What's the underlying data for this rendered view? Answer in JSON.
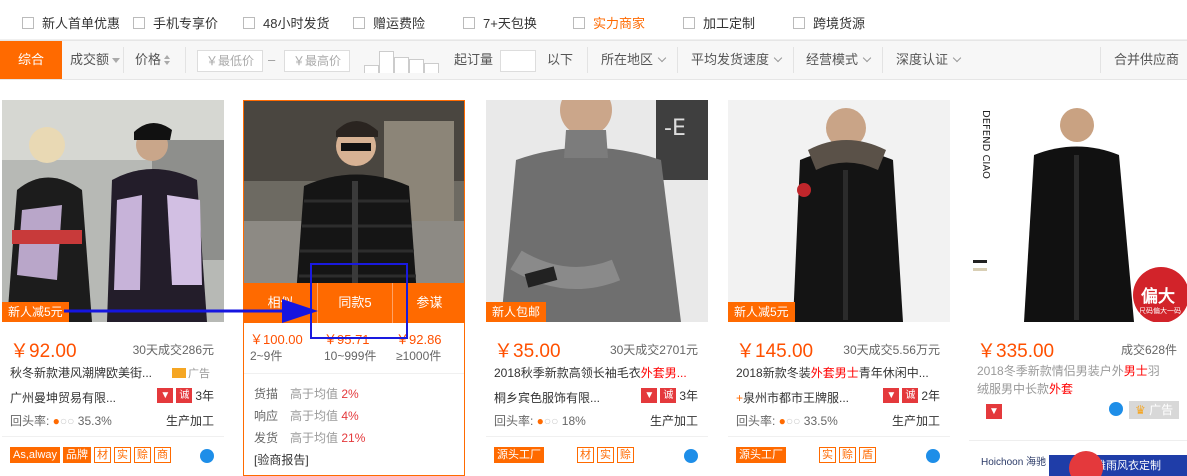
{
  "filters": [
    {
      "label": "新人首单优惠",
      "hot": false
    },
    {
      "label": "手机专享价",
      "hot": false
    },
    {
      "label": "48小时发货",
      "hot": false
    },
    {
      "label": "赠运费险",
      "hot": false
    },
    {
      "label": "7+天包换",
      "hot": false
    },
    {
      "label": "实力商家",
      "hot": true
    },
    {
      "label": "加工定制",
      "hot": false
    },
    {
      "label": "跨境货源",
      "hot": false
    }
  ],
  "sortbar": {
    "composite": "综合",
    "volume": "成交额",
    "price": "价格",
    "min_price_ph": "￥最低价",
    "dash": "–",
    "max_price_ph": "￥最高价",
    "moq_label": "起订量",
    "moq_suffix": "以下",
    "region": "所在地区",
    "ship_speed": "平均发货速度",
    "biz_mode": "经营模式",
    "cert": "深度认证",
    "merge": "合并供应商"
  },
  "colors": {
    "accent": "#ff6a00",
    "price": "#ff5000",
    "highlight_box": "#1a1adf",
    "arrow": "#1515e0"
  },
  "products": [
    {
      "tag": "新人减5元",
      "price": "￥92.00",
      "deals": "30天成交286元",
      "title_pre": "秋冬新款港风潮牌欧美街...",
      "title_em": "",
      "title_post": "",
      "company": "广州曼坤贸易有限...",
      "ad": "广告",
      "years": "3年",
      "metrics": "回头率: ",
      "rate": "35.3%",
      "mode": "生产加工",
      "icons": [
        "As,alway",
        "品牌",
        "材",
        "实",
        "赊",
        "商"
      ]
    },
    {
      "overlay": [
        "相似",
        "同款5",
        "参谋"
      ],
      "price_cols": [
        {
          "price": "￥100.00",
          "qty": "2~9件"
        },
        {
          "price": "￥95.71",
          "qty": "10~999件"
        },
        {
          "price": "￥92.86",
          "qty": "≥1000件"
        }
      ],
      "rows": [
        {
          "k": "货描",
          "v": "高于均值",
          "n": "2%"
        },
        {
          "k": "响应",
          "v": "高于均值",
          "n": "4%"
        },
        {
          "k": "发货",
          "v": "高于均值",
          "n": "21%"
        }
      ],
      "report": "[验商报告]"
    },
    {
      "tag": "新人包邮",
      "price": "￥35.00",
      "deals": "30天成交2701元",
      "title_pre": "2018秋季新款高领长袖毛衣",
      "title_em": "外套男...",
      "title_post": "",
      "company": "桐乡宾色服饰有限...",
      "years": "3年",
      "metrics": "回头率: ",
      "rate": "18%",
      "mode": "生产加工",
      "icons": [
        "源头工厂",
        "材",
        "实",
        "赊"
      ]
    },
    {
      "tag": "新人减5元",
      "price": "￥145.00",
      "deals": "30天成交5.56万元",
      "title_pre": "2018新款冬装",
      "title_em": "外套男士",
      "title_post": "青年休闲中...",
      "company": "泉州市都市王牌服...",
      "years": "2年",
      "metrics": "回头率: ",
      "rate": "33.5%",
      "mode": "生产加工",
      "icons": [
        "源头工厂",
        "实",
        "赊",
        "盾"
      ]
    },
    {
      "tag": "",
      "price": "￥335.00",
      "deals": "成交628件",
      "title_pre": "2018冬季新款情侣男装户外",
      "title_em": "男士",
      "title_post": "羽",
      "title2_pre": "绒服男中长款",
      "title2_em": "外套",
      "ad": "广告",
      "brand_banner": "偏大",
      "brand_sub": "尺码偏大一码",
      "sidelabel": "DEFEND CIAO",
      "bottom_brand": "Hoichoon 海驰",
      "bottom_ad": "雅雨风衣定制"
    }
  ]
}
